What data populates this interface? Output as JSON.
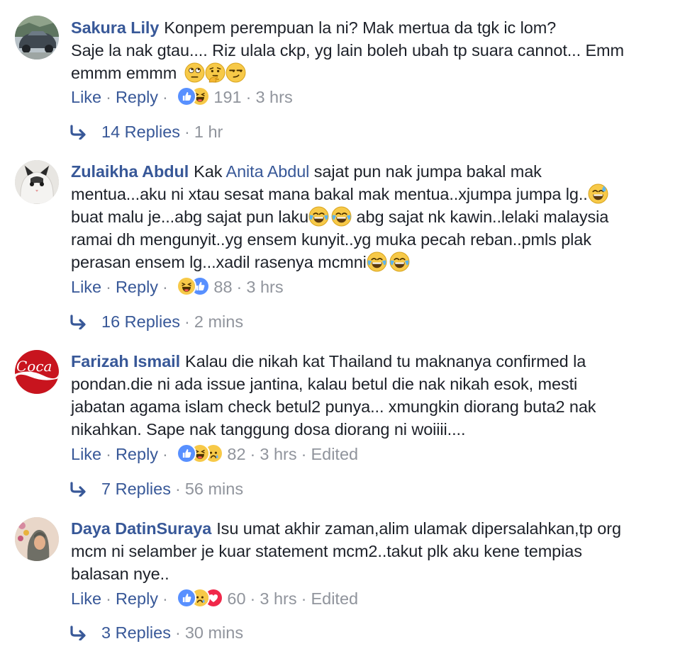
{
  "actions": {
    "like": "Like",
    "reply": "Reply"
  },
  "comments": [
    {
      "author": "Sakura Lily",
      "text_1": "Konpem perempuan la ni? Mak mertua da tgk ic lom?",
      "text_2": "Saje la nak gtau.... Riz ulala ckp, yg lain boleh ubah tp suara cannot... Emm",
      "text_3": "emmm emmm",
      "reaction_count": "191",
      "time": "3 hrs",
      "replies_label": "14 Replies",
      "replies_time": "1 hr"
    },
    {
      "author": "Zulaikha Abdul",
      "text_1a": "Kak",
      "mention": "Anita Abdul",
      "text_1b": "sajat pun nak jumpa bakal mak",
      "text_2": "mentua...aku ni xtau sesat mana bakal mak mentua..xjumpa jumpa lg..",
      "text_3a": "buat malu je...abg sajat pun laku",
      "text_3b": "abg sajat nk kawin..lelaki malaysia",
      "text_4": "ramai dh mengunyit..yg ensem kunyit..yg muka pecah reban..pmls plak",
      "text_5": "perasan ensem lg...xadil rasenya mcmni",
      "reaction_count": "88",
      "time": "3 hrs",
      "replies_label": "16 Replies",
      "replies_time": "2 mins"
    },
    {
      "author": "Farizah Ismail",
      "text_1": "Kalau die nikah kat Thailand tu maknanya confirmed la",
      "text_2": "pondan.die ni ada issue jantina, kalau betul die nak nikah esok, mesti",
      "text_3": "jabatan agama islam check betul2 punya... xmungkin diorang buta2 nak",
      "text_4": "nikahkan. Sape nak tanggung dosa diorang ni woiiii....",
      "reaction_count": "82",
      "time": "3 hrs",
      "edited": "Edited",
      "replies_label": "7 Replies",
      "replies_time": "56 mins"
    },
    {
      "author": "Daya DatinSuraya",
      "text_1": "Isu umat akhir zaman,alim ulamak dipersalahkan,tp org",
      "text_2": "mcm ni selamber je kuar statement mcm2..takut plk aku kene tempias",
      "text_3": "balasan nye..",
      "reaction_count": "60",
      "time": "3 hrs",
      "edited": "Edited",
      "replies_label": "3 Replies",
      "replies_time": "30 mins"
    }
  ],
  "colors": {
    "link": "#385898",
    "meta": "#90949c",
    "text": "#1d2129",
    "like_blue": "#5890ff",
    "haha_yellow": "#f7c948"
  }
}
